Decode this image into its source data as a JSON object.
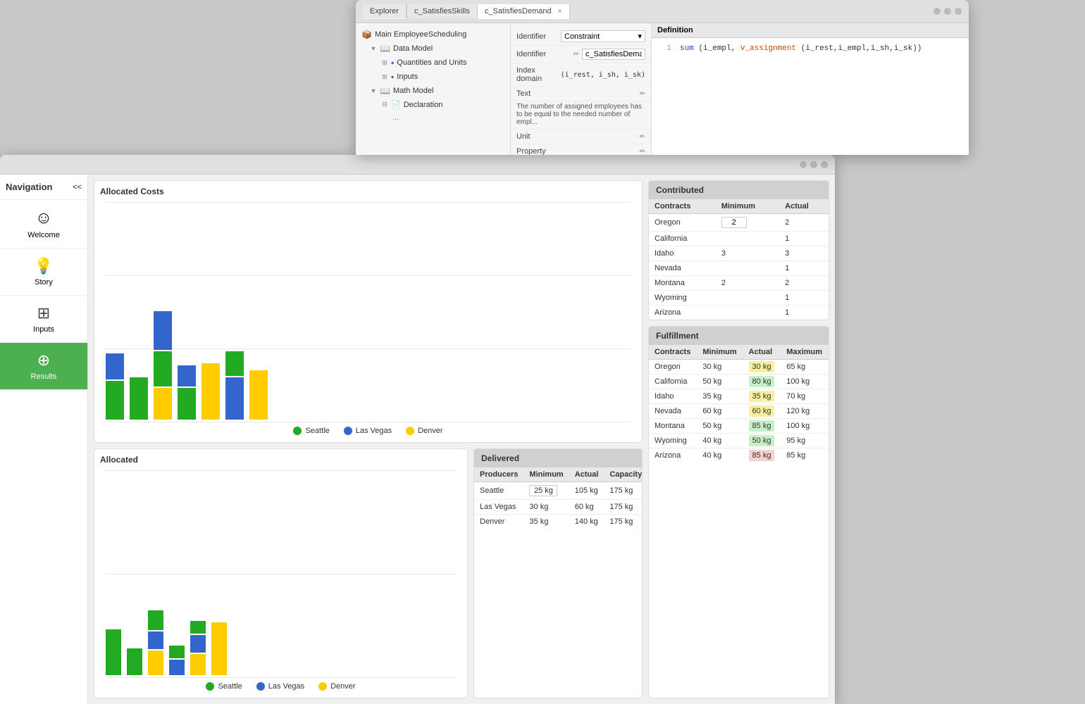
{
  "explorer": {
    "title": "Explorer",
    "close_label": "×",
    "tabs": [
      {
        "label": "c_SatisfiesSkills",
        "active": false
      },
      {
        "label": "c_SatisfiesDemand",
        "active": true
      }
    ],
    "tree": [
      {
        "label": "Main EmployeeScheduling",
        "indent": 0,
        "icon": "📦",
        "expand": ""
      },
      {
        "label": "Data Model",
        "indent": 1,
        "icon": "📖",
        "expand": "▼"
      },
      {
        "label": "Quantities and Units",
        "indent": 2,
        "icon": "▪",
        "expand": "⊞"
      },
      {
        "label": "Inputs",
        "indent": 2,
        "icon": "▪",
        "expand": "⊞"
      },
      {
        "label": "Math Model",
        "indent": 1,
        "icon": "📖",
        "expand": "▼"
      },
      {
        "label": "Declaration",
        "indent": 2,
        "icon": "📄",
        "expand": "⊟"
      }
    ],
    "properties": {
      "identifier_label": "Identifier",
      "identifier_type": "Constraint",
      "identifier_name": "c_SatisfiesDemand",
      "index_domain_label": "Index domain",
      "index_domain_value": "(i_rest, i_sh, i_sk)",
      "text_label": "Text",
      "text_value": "The number of assigned employees has to be equal to the needed number of empl...",
      "unit_label": "Unit",
      "property_label": "Property",
      "definition_label": "Definition",
      "definition_line1": "sum (i_empl, v_assignment(i_rest,i_empl,i_sh,i_sk))",
      "definition_line1_num": "1"
    }
  },
  "main_app": {
    "title": "",
    "sidebar": {
      "navigation_label": "Navigation",
      "collapse_icon": "<<",
      "items": [
        {
          "label": "Welcome",
          "icon": "☺",
          "active": false
        },
        {
          "label": "Story",
          "icon": "💡",
          "active": false
        },
        {
          "label": "Inputs",
          "icon": "⊞",
          "active": false
        },
        {
          "label": "Results",
          "icon": "⊕",
          "active": true
        }
      ]
    },
    "allocated_costs": {
      "title": "Allocated Costs",
      "legend": [
        {
          "label": "Seattle",
          "color": "#22aa22"
        },
        {
          "label": "Las Vegas",
          "color": "#3366cc"
        },
        {
          "label": "Denver",
          "color": "#ffcc00"
        }
      ],
      "bars": [
        {
          "green": 90,
          "blue": 60,
          "yellow": 0
        },
        {
          "green": 70,
          "blue": 0,
          "yellow": 0
        },
        {
          "green": 80,
          "blue": 100,
          "yellow": 60
        },
        {
          "green": 55,
          "blue": 40,
          "yellow": 0
        },
        {
          "green": 0,
          "blue": 0,
          "yellow": 110
        },
        {
          "green": 75,
          "blue": 80,
          "yellow": 0
        },
        {
          "green": 0,
          "blue": 0,
          "yellow": 90
        }
      ]
    },
    "contributed": {
      "title": "Contributed",
      "headers": [
        "Contracts",
        "Minimum",
        "Actual"
      ],
      "rows": [
        {
          "contract": "Oregon",
          "minimum": "2",
          "actual": "2"
        },
        {
          "contract": "California",
          "minimum": "",
          "actual": "1"
        },
        {
          "contract": "Idaho",
          "minimum": "3",
          "actual": "3"
        },
        {
          "contract": "Nevada",
          "minimum": "",
          "actual": "1"
        },
        {
          "contract": "Montana",
          "minimum": "2",
          "actual": "2"
        },
        {
          "contract": "Wyoming",
          "minimum": "",
          "actual": "1"
        },
        {
          "contract": "Arizona",
          "minimum": "",
          "actual": "1"
        }
      ]
    },
    "allocated": {
      "title": "Allocated",
      "legend": [
        {
          "label": "Seattle",
          "color": "#22aa22"
        },
        {
          "label": "Las Vegas",
          "color": "#3366cc"
        },
        {
          "label": "Denver",
          "color": "#ffcc00"
        }
      ]
    },
    "delivered": {
      "title": "Delivered",
      "headers": [
        "Producers",
        "Minimum",
        "Actual",
        "Capacity"
      ],
      "rows": [
        {
          "producer": "Seattle",
          "minimum": "25 kg",
          "actual": "105 kg",
          "capacity": "175 kg"
        },
        {
          "producer": "Las Vegas",
          "minimum": "30 kg",
          "actual": "60 kg",
          "capacity": "175 kg"
        },
        {
          "producer": "Denver",
          "minimum": "35 kg",
          "actual": "140 kg",
          "capacity": "175 kg"
        }
      ]
    },
    "fulfillment": {
      "title": "Fulfillment",
      "headers": [
        "Contracts",
        "Minimum",
        "Actual",
        "Maximum"
      ],
      "rows": [
        {
          "contract": "Oregon",
          "minimum": "30 kg",
          "actual": "30 kg",
          "maximum": "65 kg",
          "actual_color": "yellow"
        },
        {
          "contract": "California",
          "minimum": "50 kg",
          "actual": "80 kg",
          "maximum": "100 kg",
          "actual_color": "green"
        },
        {
          "contract": "Idaho",
          "minimum": "35 kg",
          "actual": "35 kg",
          "maximum": "70 kg",
          "actual_color": "yellow"
        },
        {
          "contract": "Nevada",
          "minimum": "60 kg",
          "actual": "60 kg",
          "maximum": "120 kg",
          "actual_color": "yellow"
        },
        {
          "contract": "Montana",
          "minimum": "50 kg",
          "actual": "85 kg",
          "maximum": "100 kg",
          "actual_color": "green"
        },
        {
          "contract": "Wyoming",
          "minimum": "40 kg",
          "actual": "50 kg",
          "maximum": "95 kg",
          "actual_color": "green"
        },
        {
          "contract": "Arizona",
          "minimum": "40 kg",
          "actual": "85 kg",
          "maximum": "85 kg",
          "actual_color": "red"
        }
      ]
    }
  }
}
